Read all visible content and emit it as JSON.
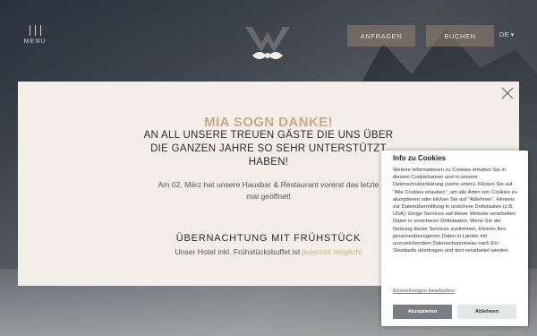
{
  "header": {
    "menu_label": "MENU",
    "anfragen_label": "ANFRAGEN",
    "buchen_label": "BUCHEN",
    "language": "DE",
    "accent_color": "#9a8270"
  },
  "modal": {
    "title": "MIA SOGN DANKE!",
    "subtitle": "AN ALL UNSERE TREUEN GÄSTE DIE UNS ÜBER DIE GANZEN JAHRE SO SEHR UNTERSTÜTZT HABEN!",
    "body": "Am 02. März hat unsere Hausbar & Restaurant vorerst das letzte mal geöffnet!",
    "heading2": "ÜBERNACHTUNG MIT FRÜHSTÜCK",
    "line_prefix": "Unser Hotel inkl. Frühstücksbuffet ist ",
    "line_highlight": "jederzeit möglich!",
    "title_color": "#c9a985",
    "highlight_color": "#d4b07f"
  },
  "cookie": {
    "title": "Info zu Cookies",
    "text": "Weitere Informationen zu Cookies erhalten Sie in diesem Cookiebanner und in unserer Datenschutzerklärung (siehe unten). Klicken Sie auf \"Alle Cookies erlauben\", um alle Arten von Cookies zu akzeptieren oder klicken Sie auf \"Ablehnen\". Hinweis zur Datenübermittlung in unsichere Drittstaaten (z.B. USA): Einige Services auf dieser Website verarbeiten Daten in unsicheren Drittstaaten. Wenn Sie der Nutzung dieser Services zustimmen, können Ihre personenbezogenen Daten in Länder mit unzureichendem Datenschutzniveau nach EU-Standards übertragen und dort verarbeitet werden.",
    "settings_link": "Einstellungen bearbeiten",
    "accept_label": "Akzeptieren",
    "reject_label": "Ablehnen"
  }
}
